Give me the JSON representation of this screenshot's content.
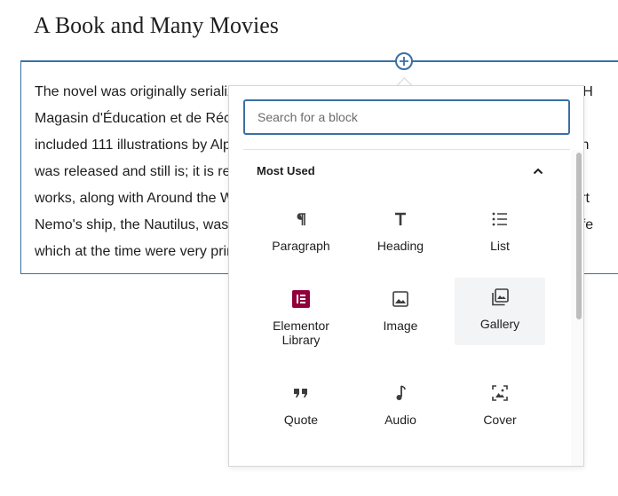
{
  "heading": "A Book and Many Movies",
  "paragraph_lines": [
    "The novel was originally serialized from March 1869 through June 1870 in Pierre-Jules H",
    "Magasin d'Éducation et de Récréation. A deluxe octavo edition, published by Hetze",
    "included 111 illustrations by Alphonse de Neuville and Édouard Riou. The book was high",
    "was released and still is; it is regarded as one of the premier adventure novels and one",
    "works, along with Around the World in Eighty Days and Journey to the Center of the Eart",
    "Nemo's ship, the Nautilus, was considered ahead of its time, as it accurately describes fe",
    "which at the time were very primitive."
  ],
  "inserter": {
    "search_placeholder": "Search for a block",
    "section_title": "Most Used",
    "blocks": [
      {
        "label": "Paragraph",
        "icon": "paragraph-icon"
      },
      {
        "label": "Heading",
        "icon": "heading-icon"
      },
      {
        "label": "List",
        "icon": "list-icon"
      },
      {
        "label": "Elementor Library",
        "icon": "elementor-icon"
      },
      {
        "label": "Image",
        "icon": "image-icon"
      },
      {
        "label": "Gallery",
        "icon": "gallery-icon"
      },
      {
        "label": "Quote",
        "icon": "quote-icon"
      },
      {
        "label": "Audio",
        "icon": "audio-icon"
      },
      {
        "label": "Cover",
        "icon": "cover-icon"
      }
    ]
  },
  "colors": {
    "accent": "#3a6fa5",
    "elementor": "#92003b"
  }
}
